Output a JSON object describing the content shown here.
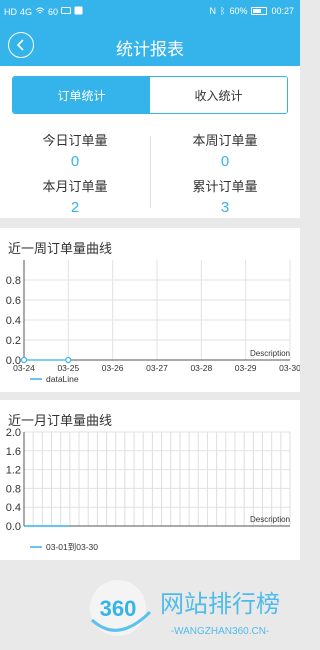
{
  "status_bar": {
    "left_icons": [
      "HD",
      "4G",
      "wifi-icon",
      "60",
      "message-icon",
      "app-icon"
    ],
    "battery_percent": "60%",
    "time": "00:27"
  },
  "appbar": {
    "title": "统计报表",
    "back_icon": "chevron-left-icon"
  },
  "tabs": [
    {
      "label": "订单统计",
      "active": true
    },
    {
      "label": "收入统计",
      "active": false
    }
  ],
  "stats": [
    {
      "label": "今日订单量",
      "value": "0"
    },
    {
      "label": "本周订单量",
      "value": "0"
    },
    {
      "label": "本月订单量",
      "value": "2"
    },
    {
      "label": "累计订单量",
      "value": "3"
    }
  ],
  "week_chart": {
    "title": "近一周订单量曲线",
    "chart_data": {
      "type": "line",
      "categories": [
        "03-24",
        "03-25",
        "03-26",
        "03-27",
        "03-28",
        "03-29",
        "03-30"
      ],
      "series": [
        {
          "name": "dataLine",
          "values": [
            0,
            0
          ]
        }
      ],
      "y_ticks": [
        "0.0",
        "0.2",
        "0.4",
        "0.6",
        "0.8"
      ],
      "ylim": [
        0,
        1.0
      ],
      "description": "Description",
      "legend": "bottom-left",
      "grid": true,
      "color": "#35b4ec"
    }
  },
  "month_chart": {
    "title": "近一月订单量曲线",
    "chart_data": {
      "type": "line",
      "series": [
        {
          "name": "03-01到03-30",
          "values": [
            0,
            0,
            0,
            0,
            0,
            0
          ]
        }
      ],
      "y_ticks": [
        "0.0",
        "0.4",
        "0.8",
        "1.2",
        "1.6",
        "2.0"
      ],
      "ylim": [
        0,
        2.0
      ],
      "description": "Description",
      "legend": "bottom-left",
      "grid": true,
      "color": "#35b4ec"
    }
  },
  "watermark": {
    "logo_text": "360",
    "title": "网站排行榜",
    "subtitle": "-WANGZHAN360.CN-"
  },
  "colors": {
    "accent": "#35b4ec",
    "background": "#e9e9e9"
  }
}
